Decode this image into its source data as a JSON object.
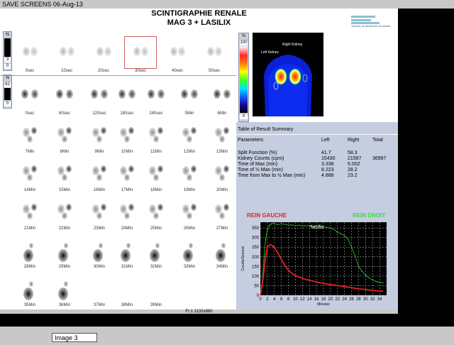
{
  "window": {
    "title": "SAVE  SCREENS 06-Aug-13"
  },
  "header": {
    "line1": "SCINTIGRAPHIE RENALE",
    "line2": "MAG 3 + LASILIX"
  },
  "logo": {
    "text": "Service de Médecine Nucléaire"
  },
  "controls": {
    "top": {
      "percent_label": "%",
      "value_a": "3",
      "value_b": "0"
    },
    "bottom": {
      "percent_label": "%",
      "value_a": "62",
      "value_b": "0"
    },
    "colorbar": {
      "percent_label": "%",
      "max": "100",
      "min": "0"
    }
  },
  "flow_frames": [
    "0sec",
    "10sec",
    "20sec",
    "30sec",
    "40sec",
    "50sec"
  ],
  "dynamic_frames": [
    [
      "0sec",
      "60sec",
      "120sec",
      "180sec",
      "240sec",
      "5Min",
      "6Min"
    ],
    [
      "7Min",
      "8Min",
      "9Min",
      "10Min",
      "11Min",
      "12Min",
      "13Min"
    ],
    [
      "14Min",
      "15Min",
      "16Min",
      "17Min",
      "18Min",
      "19Min",
      "20Min"
    ],
    [
      "21Min",
      "22Min",
      "23Min",
      "24Min",
      "25Min",
      "26Min",
      "27Min"
    ],
    [
      "28Min",
      "29Min",
      "30Min",
      "31Min",
      "32Min",
      "33Min",
      "34Min"
    ],
    [
      "35Min",
      "36Min",
      "37Min",
      "38Min",
      "39Min"
    ]
  ],
  "roi_image": {
    "right_label": "Right Kidney",
    "left_label": "Left Kidney"
  },
  "summary": {
    "title": "Table of Result Summary",
    "headers": [
      "Parameters",
      "Left",
      "Right",
      "Total"
    ],
    "rows": [
      [
        "Split Function (%)",
        "41.7",
        "58.3",
        ""
      ],
      [
        "Kidney Counts (cpm)",
        "15430",
        "21567",
        "36997"
      ],
      [
        "Time of Max (min)",
        "3.336",
        "5.002",
        ""
      ],
      [
        "Time of ½ Max (min)",
        "8.223",
        "28.2",
        ""
      ],
      [
        "Time from Max to ½ Max (min)",
        "4.888",
        "23.2",
        ""
      ]
    ]
  },
  "chart_data": {
    "type": "line",
    "title": "",
    "left_label": "REIN GAUCHE",
    "right_label": "REIN DROIT",
    "annotation": "*lasilix",
    "xlabel": "Minutes",
    "ylabel": "Counts/Second",
    "xlim": [
      0,
      36
    ],
    "ylim": [
      0,
      380
    ],
    "xticks": [
      "0",
      "2",
      "4",
      "6",
      "8",
      "10",
      "12",
      "14",
      "16",
      "18",
      "20",
      "22",
      "24",
      "26",
      "28",
      "30",
      "32",
      "34"
    ],
    "yticks": [
      "0",
      "50",
      "100",
      "150",
      "200",
      "250",
      "300",
      "350"
    ],
    "grid": true,
    "series": [
      {
        "name": "REIN DROIT",
        "color": "#3cff3c",
        "x": [
          0,
          0.5,
          1,
          1.5,
          2,
          2.5,
          3,
          3.5,
          4,
          5,
          6,
          7,
          8,
          9,
          10,
          11,
          12,
          13,
          14,
          15,
          16,
          17,
          18,
          19,
          20,
          21,
          22,
          23,
          24,
          25,
          26,
          27,
          28,
          29,
          30,
          31,
          32,
          33,
          34,
          35
        ],
        "y": [
          0,
          60,
          180,
          290,
          340,
          362,
          370,
          374,
          372,
          368,
          372,
          369,
          365,
          366,
          362,
          364,
          360,
          361,
          363,
          358,
          362,
          360,
          356,
          353,
          350,
          342,
          328,
          320,
          310,
          292,
          250,
          205,
          150,
          125,
          105,
          90,
          80,
          72,
          68,
          64
        ]
      },
      {
        "name": "REIN GAUCHE",
        "color": "#ff2020",
        "x": [
          0,
          0.5,
          1,
          1.5,
          2,
          2.5,
          3,
          3.5,
          4,
          5,
          6,
          7,
          8,
          9,
          10,
          11,
          12,
          13,
          14,
          15,
          16,
          17,
          18,
          19,
          20,
          21,
          22,
          23,
          24,
          25,
          26,
          27,
          28,
          29,
          30,
          31,
          32,
          33,
          34,
          35
        ],
        "y": [
          0,
          50,
          120,
          200,
          250,
          262,
          262,
          258,
          248,
          220,
          185,
          155,
          130,
          115,
          102,
          95,
          88,
          82,
          78,
          74,
          70,
          66,
          62,
          58,
          56,
          53,
          50,
          48,
          45,
          42,
          40,
          36,
          34,
          32,
          30,
          28,
          26,
          24,
          22,
          21
        ]
      }
    ]
  },
  "status": {
    "text": "Fr:1 1132x860"
  },
  "bottom": {
    "image_label": "Image 3"
  }
}
